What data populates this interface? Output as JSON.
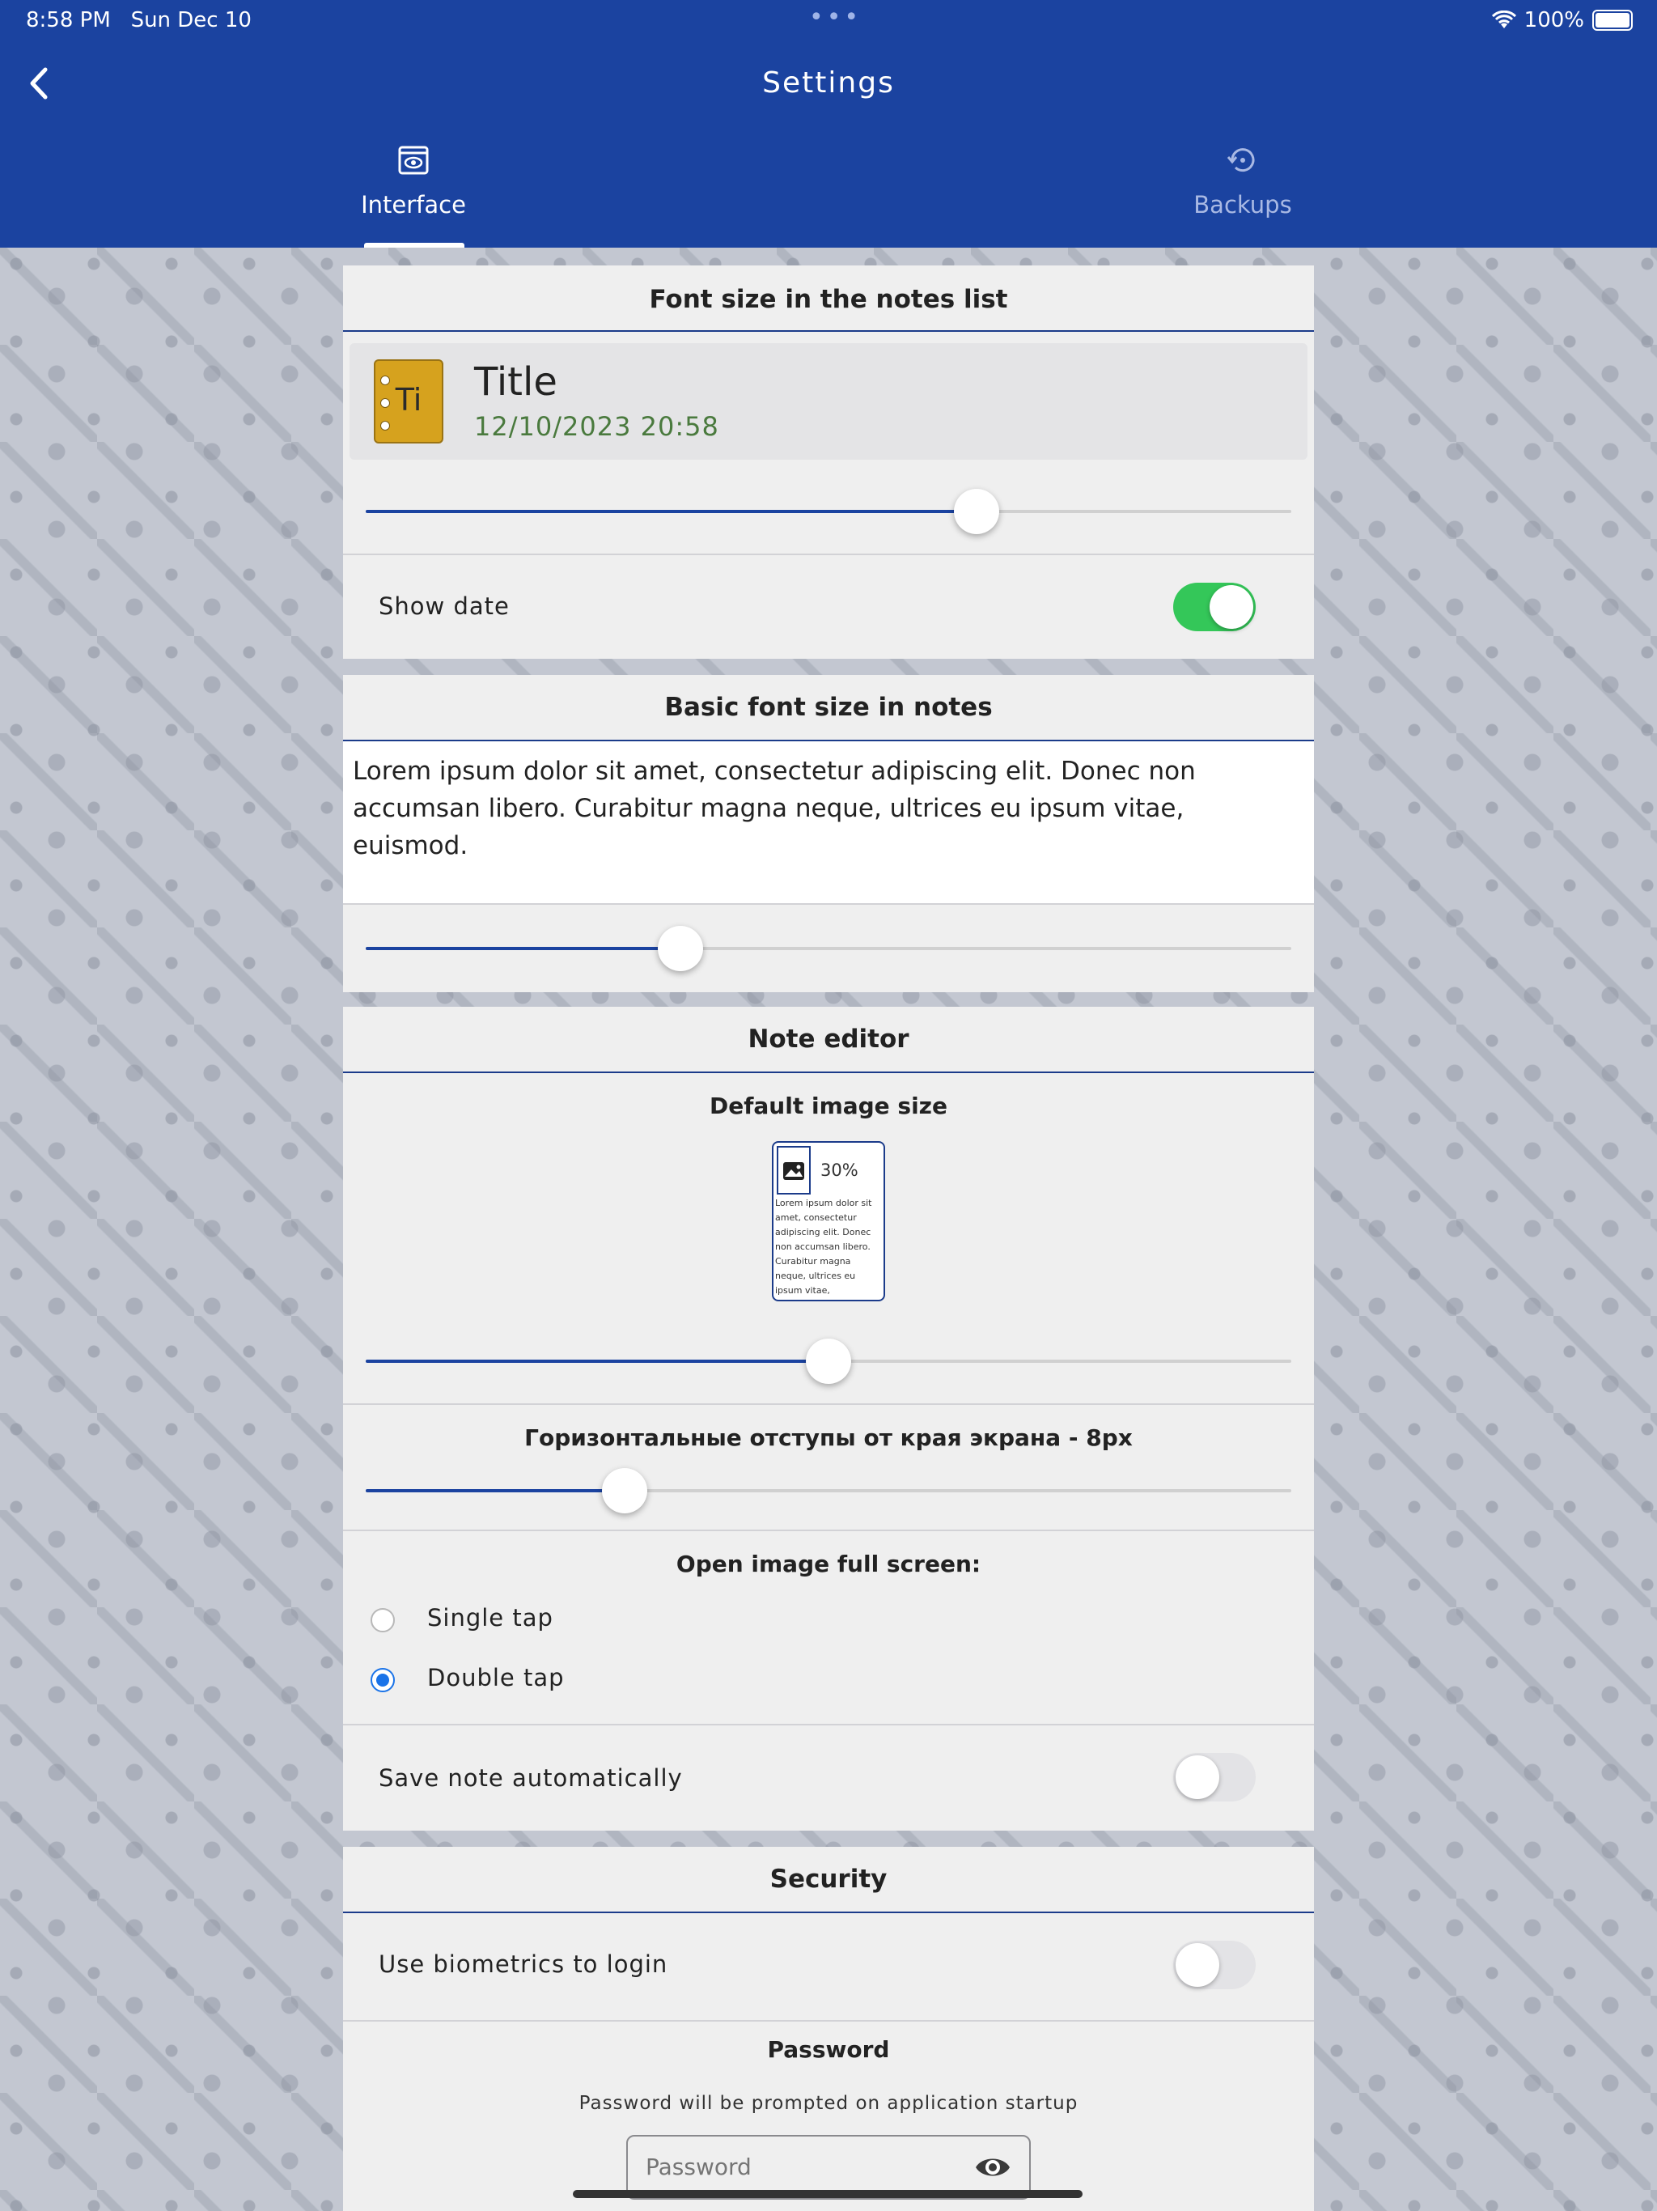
{
  "status": {
    "time": "8:58 PM",
    "date": "Sun Dec 10",
    "battery": "100%",
    "dots": "•••"
  },
  "header": {
    "title": "Settings"
  },
  "tabs": [
    {
      "label": "Interface",
      "active": true
    },
    {
      "label": "Backups",
      "active": false
    }
  ],
  "notes_list": {
    "title": "Font size in the notes list",
    "preview_icon_text": "Ti",
    "preview_title": "Title",
    "preview_date": "12/10/2023 20:58",
    "slider_value": 0.66,
    "show_date_label": "Show date",
    "show_date": true
  },
  "basic_font": {
    "title": "Basic font size in notes",
    "sample": "Lorem ipsum dolor sit amet, consectetur adipiscing elit. Donec non accumsan libero. Curabitur magna neque, ultrices eu ipsum vitae, euismod.",
    "slider_value": 0.34
  },
  "editor": {
    "title": "Note editor",
    "image_size_label": "Default image size",
    "image_percent": "30%",
    "image_preview_text": "Lorem ipsum dolor sit amet, consectetur adipiscing elit. Donec non accumsan libero. Curabitur magna neque, ultrices eu ipsum vitae,",
    "image_slider_value": 0.5,
    "margins_label": "Горизонтальные отступы от края экрана - 8px",
    "margins_slider_value": 0.28,
    "open_image_label": "Open image full screen:",
    "options": [
      {
        "label": "Single tap",
        "selected": false
      },
      {
        "label": "Double tap",
        "selected": true
      }
    ],
    "autosave_label": "Save note automatically",
    "autosave": false
  },
  "security": {
    "title": "Security",
    "biometrics_label": "Use biometrics to login",
    "biometrics": false,
    "password_title": "Password",
    "password_hint": "Password will be prompted on application startup",
    "password_placeholder": "Password"
  },
  "colors": {
    "header": "#1b43a0",
    "accent": "#1a73e8",
    "toggle_on": "#34c759",
    "date": "#4a7a3e"
  }
}
